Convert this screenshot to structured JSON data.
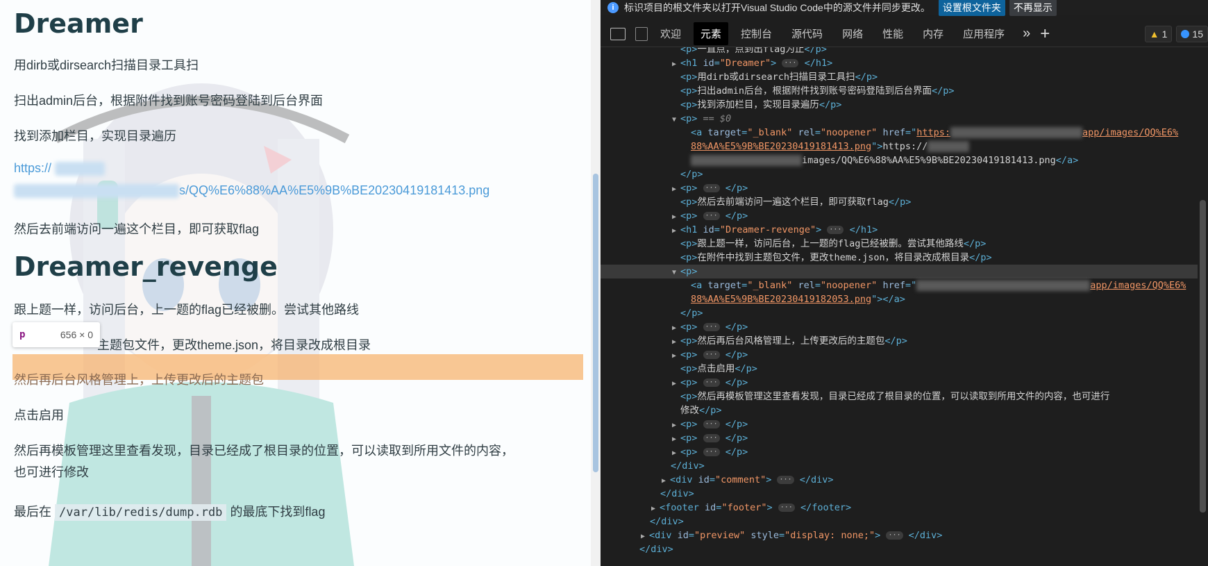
{
  "page": {
    "h1_dreamer": "Dreamer",
    "p1": "用dirb或dirsearch扫描目录工具扫",
    "p2": "扫出admin后台，根据附件找到账号密码登陆到后台界面",
    "p3": "找到添加栏目，实现目录遍历",
    "link_line1": "https://",
    "link_line2": "s/QQ%E6%88%AA%E5%9B%BE20230419181413.png",
    "p4": "然后去前端访问一遍这个栏目，即可获取flag",
    "h1_revenge": "Dreamer_revenge",
    "p5": "跟上题一样，访问后台，上一题的flag已经被删。尝试其他路线",
    "p6_partial": "主题包文件，更改theme.json，将目录改成根目录",
    "p7": "然后再后台风格管理上，上传更改后的主题包",
    "p8": "点击启用",
    "p9a": "然后再模板管理这里查看发现，目录已经成了根目录的位置，可以读取到所用文件的内容，",
    "p9b": "也可进行修改",
    "p10_prefix": "最后在",
    "p10_code": "/var/lib/redis/dump.rdb",
    "p10_suffix": "的最底下找到flag",
    "tooltip_tag": "p",
    "tooltip_dims": "656 × 0"
  },
  "devtools": {
    "infobar_text": "标识项目的根文件夹以打开Visual Studio Code中的源文件并同步更改。",
    "infobar_btn_primary": "设置根文件夹",
    "infobar_btn_secondary": "不再显示",
    "tabs": [
      "欢迎",
      "元素",
      "控制台",
      "源代码",
      "网络",
      "性能",
      "内存",
      "应用程序"
    ],
    "warn_count": "1",
    "msg_count": "15",
    "lines": {
      "l0": "一直点，点到出flag为止",
      "l1_id": "\"Dreamer\"",
      "l2": "用dirb或dirsearch扫描目录工具扫",
      "l3": "扫出admin后台，根据附件找到账号密码登陆到后台界面",
      "l4": "找到添加栏目，实现目录遍历",
      "l5_eq": "== $0",
      "l6_target": "\"_blank\"",
      "l6_rel": "\"noopener\"",
      "l6_href_start": "https:",
      "l6_href_end": "app/images/QQ%E6%",
      "l7_href_cont": "88%AA%E5%9B%BE20230419181413.png",
      "l7_text": "https://",
      "l8_text": "images/QQ%E6%88%AA%E5%9B%BE20230419181413.png",
      "l11": "然后去前端访问一遍这个栏目，即可获取flag",
      "l13_id": "\"Dreamer-revenge\"",
      "l14": "跟上题一样，访问后台，上一题的flag已经被删。尝试其他路线",
      "l15": "在附件中找到主题包文件，更改theme.json，将目录改成根目录",
      "l17_href_end": "app/images/QQ%E6%",
      "l18_href_cont": "88%AA%E5%9B%BE20230419182053.png",
      "l21": "然后再后台风格管理上，上传更改后的主题包",
      "l23": "点击启用",
      "l25": "然后再模板管理这里查看发现，目录已经成了根目录的位置，可以读取到所用文件的内容，也可进行",
      "l26": "修改",
      "l31_id": "\"comment\"",
      "l33_id": "\"footer\"",
      "l35_id": "\"preview\"",
      "l35_style": "\"display: none;\""
    }
  }
}
